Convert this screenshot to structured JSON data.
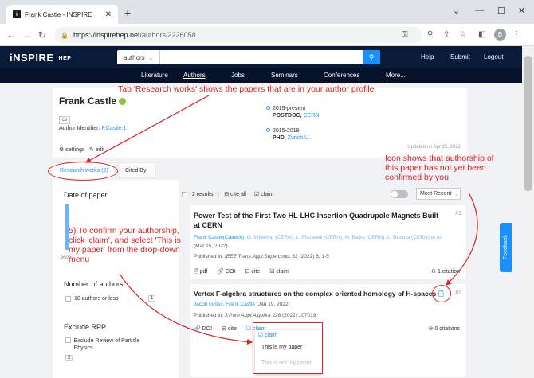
{
  "browser": {
    "tab_title": "Frank Castle - INSPIRE",
    "tab_favicon": "i",
    "url_host": "https://inspirehep.net",
    "url_path": "/authors/2226058",
    "profile_initial": "B"
  },
  "header": {
    "logo": "iNSPIRE",
    "logo_sub": "HEP",
    "search_scope": "authors",
    "links": [
      "Help",
      "Submit",
      "Logout"
    ]
  },
  "subnav": {
    "items": [
      "Literature",
      "Authors",
      "Jobs",
      "Seminars",
      "Conferences",
      "More..."
    ],
    "active": "Authors"
  },
  "profile": {
    "name": "Frank Castle",
    "tag": "cs",
    "identifier_label": "Author Identifier:",
    "identifier": "F.Castle.1",
    "settings": "settings",
    "edit": "edit",
    "positions": [
      {
        "period": "2019-present",
        "role": "POSTDOC,",
        "institution": "CERN"
      },
      {
        "period": "2015-2019",
        "role": "PHD,",
        "institution": "Zurich U."
      }
    ],
    "updated": "Updated on Apr 25, 2022"
  },
  "tabs": {
    "research": "Research works (2)",
    "cited_by": "Cited By"
  },
  "facets": {
    "date_title": "Date of paper",
    "year_label": "2022",
    "authors_title": "Number of authors",
    "authors_option": "10 authors or less",
    "authors_count": "1",
    "exclude_title": "Exclude RPP",
    "exclude_option": "Exclude Review of Particle Physics",
    "exclude_count": "2"
  },
  "results_bar": {
    "count": "2 results",
    "cite_all": "cite all",
    "claim": "claim",
    "sort": "Most Recent"
  },
  "results": [
    {
      "title": "Power Test of the First Two HL-LHC Insertion Quadrupole Magnets Built at CERN",
      "authors_main": "Frank Castle(Caltech),",
      "authors_rest": "G. Willering (CERN), L. Fiscarelli (CERN), M. Bajko (CERN), L. Bottura (CERN) et al.",
      "date": "(Mar 15, 2022)",
      "published_prefix": "Published in:",
      "journal": "IEEE Trans.Appl.Supercond.",
      "journal_details": "32 (2022) 6, 1-5",
      "number": "#1",
      "actions": [
        "pdf",
        "DOI",
        "cite",
        "claim"
      ],
      "citations": "1 citation"
    },
    {
      "title": "Vertex F-algebra structures on the complex oriented homology of H-spaces",
      "authors_main": "Jacob Gross, Frank Castle",
      "date": "(Jan 19, 2022)",
      "published_prefix": "Published in:",
      "journal": "J.Pure Appl.Algebra",
      "journal_details": "226 (2022) 107019",
      "number": "#2",
      "actions": [
        "DOI",
        "cite",
        "claim"
      ],
      "citations": "0 citations"
    }
  ],
  "claim_menu": {
    "header": "claim",
    "option_mine": "This is my paper",
    "option_not_mine": "This is not my paper"
  },
  "feedback": "Feedback",
  "annotations": {
    "tab_note": "Tab 'Research works' shows the papers that are in your author profile",
    "icon_note": "Icon shows that authorship of this paper has not yet been confirmed by you",
    "claim_note": "5) To confirm your authorship, click 'claim', and select 'This is my paper' from the drop-down menu"
  },
  "colors": {
    "inspire_navy": "#0a1b3a",
    "accent_blue": "#1890ff",
    "annotation_red": "#e02020"
  }
}
